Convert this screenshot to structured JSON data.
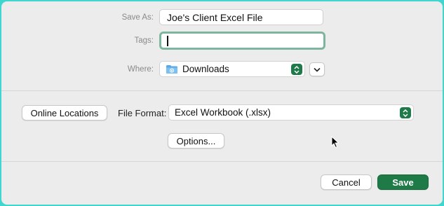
{
  "save_as": {
    "label": "Save As:",
    "value": "Joe's Client Excel File"
  },
  "tags": {
    "label": "Tags:",
    "value": ""
  },
  "where": {
    "label": "Where:",
    "value": "Downloads",
    "icon": "folder-icon"
  },
  "online_locations_label": "Online Locations",
  "file_format": {
    "label": "File Format:",
    "value": "Excel Workbook (.xlsx)"
  },
  "options_label": "Options...",
  "cancel_label": "Cancel",
  "save_label": "Save",
  "colors": {
    "accent": "#1e7a47",
    "focus_ring": "#7db59e",
    "background": "#3fd6cf"
  }
}
